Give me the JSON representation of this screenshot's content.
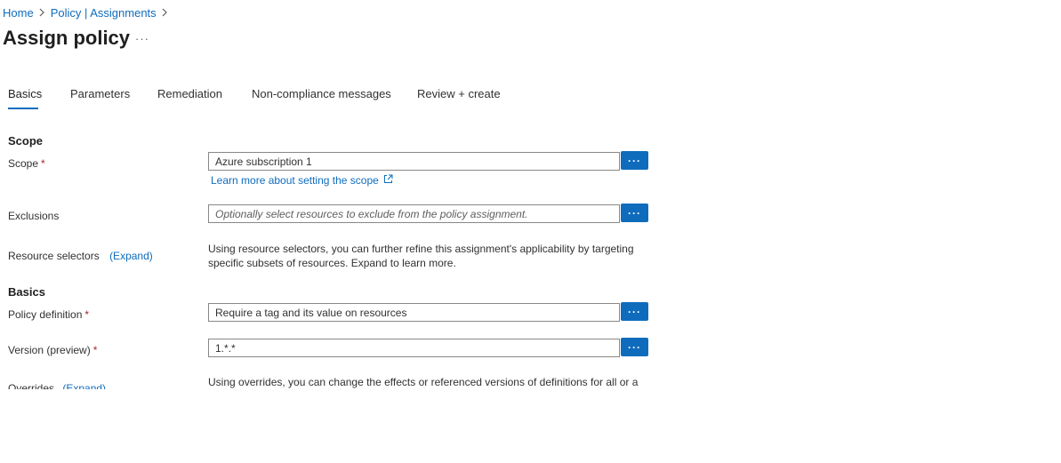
{
  "breadcrumb": {
    "home": "Home",
    "assignments": "Policy | Assignments",
    "sep": ">"
  },
  "page": {
    "title": "Assign policy",
    "more": "···"
  },
  "tabs": [
    {
      "label": "Basics"
    },
    {
      "label": "Parameters"
    },
    {
      "label": "Remediation"
    },
    {
      "label": "Non-compliance messages"
    },
    {
      "label": "Review + create"
    }
  ],
  "scope_section": {
    "heading": "Scope",
    "scope_label": "Scope",
    "scope_value": "Azure subscription 1",
    "learn_more": "Learn more about setting the scope",
    "exclusions_label": "Exclusions",
    "exclusions_placeholder": "Optionally select resources to exclude from the policy assignment.",
    "resource_selectors_label": "Resource selectors",
    "resource_selectors_expand": "(Expand)",
    "resource_selectors_desc": "Using resource selectors, you can further refine this assignment's applicability by targeting specific subsets of resources. Expand to learn more."
  },
  "basics_section": {
    "heading": "Basics",
    "policy_definition_label": "Policy definition",
    "policy_definition_value": "Require a tag and its value on resources",
    "version_label": "Version (preview)",
    "version_value": "1.*.*",
    "overrides_label": "Overrides",
    "overrides_expand": "(Expand)",
    "overrides_desc": "Using overrides, you can change the effects or referenced versions of definitions for all or a"
  },
  "common": {
    "required_mark": "*",
    "browse_button": "···"
  },
  "colors": {
    "accent": "#0f6cbd",
    "required": "#a4262c",
    "border": "#8a8886"
  }
}
